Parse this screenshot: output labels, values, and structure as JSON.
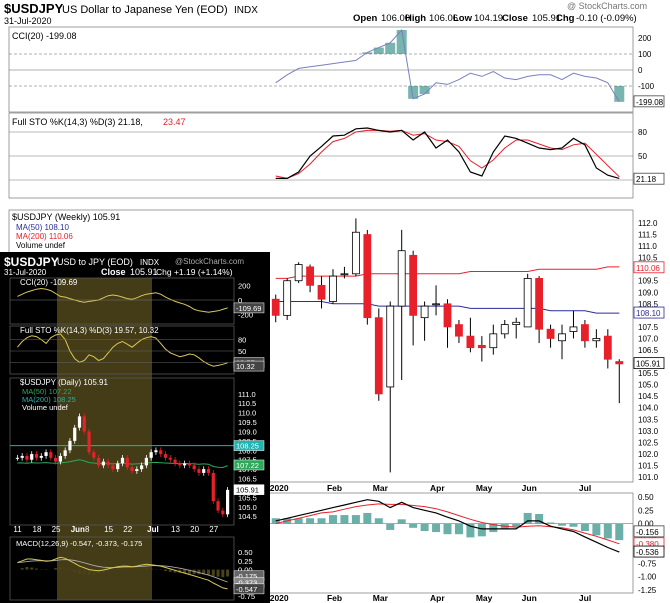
{
  "header": {
    "symbol": "$USDJPY",
    "name": "US Dollar to Japanese Yen (EOD)",
    "exchange": "INDX",
    "date": "31-Jul-2020",
    "watermark": "@ StockCharts.com",
    "quote": {
      "open_label": "Open",
      "open": "106.00",
      "high_label": "High",
      "high": "106.06",
      "low_label": "Low",
      "low": "104.19",
      "close_label": "Close",
      "close": "105.91",
      "chg_label": "Chg",
      "chg": "-0.10 (-0.09%)"
    }
  },
  "weekly": {
    "cci_label": "CCI(20) -199.08",
    "cci_last": "-199.08",
    "sto_label_a": "Full STO %K(14,3) %D(3) 21.18,",
    "sto_label_b": "23.47",
    "sto_last": "21.18",
    "price_label": "$USDJPY (Weekly) 105.91",
    "ma50_label": "MA(50) 108.10",
    "ma200_label": "MA(200) 110.06",
    "volume_label": "Volume undef",
    "ma50_last": "108.10",
    "ma200_last": "110.06",
    "close_last": "105.91",
    "x_labels": [
      "2020",
      "Feb",
      "Mar",
      "Apr",
      "May",
      "Jun",
      "Jul"
    ],
    "cci_ticks": [
      "200",
      "100",
      "0",
      "-100",
      "-200"
    ],
    "sto_ticks": [
      "80",
      "50",
      "20"
    ],
    "price_ticks": [
      "112.0",
      "111.5",
      "111.0",
      "110.5",
      "110.0",
      "109.5",
      "109.0",
      "108.5",
      "108.0",
      "107.5",
      "107.0",
      "106.5",
      "106.0",
      "105.5",
      "105.0",
      "104.5",
      "104.0",
      "103.5",
      "103.0",
      "102.5",
      "102.0",
      "101.5",
      "101.0"
    ],
    "macd_ticks": [
      "0.50",
      "0.25",
      "0.00",
      "-0.25",
      "-0.50",
      "-0.75",
      "-1.00",
      "-1.25"
    ],
    "macd_last_vals": [
      "-0.156",
      "-0.380",
      "-0.536"
    ]
  },
  "daily": {
    "title": "$USDJPY",
    "name": "USD to JPY (EOD)",
    "exchange": "INDX",
    "date": "31-Jul-2020",
    "watermark": "@StockCharts.com",
    "close_label": "Close",
    "close": "105.91",
    "chg": "Chg +1.19 (+1.14%)",
    "cci_label": "CCI(20) -109.69",
    "cci_last": "-109.69",
    "sto_label": "Full STO %K(14,3) %D(3) 19.57, 10.32",
    "sto_last_a": "19.57",
    "sto_last_b": "10.32",
    "price_label": "$USDJPY (Daily) 105.91",
    "ma50_label": "MA(50) 107.22",
    "ma200_label": "MA(200) 108.25",
    "volume_label": "Volume undef",
    "ma200_last": "108.25",
    "ma50_last": "107.22",
    "close_last": "105.91",
    "macd_label": "MACD(12,26,9) -0.547, -0.373, -0.175",
    "macd_last": [
      "-0.175",
      "-0.373",
      "-0.547"
    ],
    "cci_ticks": [
      "200",
      "0",
      "-200"
    ],
    "sto_ticks": [
      "80",
      "50",
      "20"
    ],
    "price_ticks": [
      "111.0",
      "110.5",
      "110.0",
      "109.5",
      "109.0",
      "108.5",
      "108.0",
      "107.5",
      "107.0",
      "106.5",
      "106.0",
      "105.5",
      "105.0",
      "104.5"
    ],
    "macd_ticks": [
      "0.50",
      "0.25",
      "0.00",
      "-0.25",
      "-0.50",
      "-0.75"
    ],
    "x_labels": [
      "11",
      "18",
      "25",
      "Jun",
      "8",
      "15",
      "22",
      "Jul",
      "13",
      "20",
      "27"
    ]
  },
  "colors": {
    "up": "#ffffff",
    "down": "#e8202a",
    "ma50": "#2b2b9a",
    "ma200": "#e8202a",
    "sto_d": "#e8202a",
    "cci_fill": "#5fa8a0",
    "macd_hist": "#6ab0a8",
    "daily_bg": "#000000",
    "daily_shade": "#4a4318",
    "daily_line": "#d8c85a",
    "daily_ma50": "#2ea85a",
    "daily_ma200": "#1fb5b0"
  },
  "chart_data": [
    {
      "type": "candlestick",
      "title": "$USDJPY (Weekly) 105.91",
      "timeframe": "weekly",
      "ylim": [
        101.0,
        112.0
      ],
      "x": [
        "2019-12-30",
        "2020-01-06",
        "2020-01-13",
        "2020-01-20",
        "2020-01-27",
        "2020-02-03",
        "2020-02-10",
        "2020-02-17",
        "2020-02-24",
        "2020-03-02",
        "2020-03-09",
        "2020-03-16",
        "2020-03-23",
        "2020-03-30",
        "2020-04-06",
        "2020-04-13",
        "2020-04-20",
        "2020-04-27",
        "2020-05-04",
        "2020-05-11",
        "2020-05-18",
        "2020-05-25",
        "2020-06-01",
        "2020-06-08",
        "2020-06-15",
        "2020-06-22",
        "2020-06-29",
        "2020-07-06",
        "2020-07-13",
        "2020-07-20",
        "2020-07-27"
      ],
      "ohlc": [
        [
          108.7,
          108.9,
          107.7,
          108.0
        ],
        [
          108.0,
          109.6,
          107.8,
          109.5
        ],
        [
          109.5,
          110.3,
          109.4,
          110.2
        ],
        [
          110.1,
          110.2,
          109.0,
          109.3
        ],
        [
          109.3,
          109.7,
          108.3,
          108.7
        ],
        [
          108.6,
          110.0,
          108.5,
          109.7
        ],
        [
          109.8,
          110.1,
          109.6,
          109.8
        ],
        [
          109.8,
          112.2,
          109.7,
          111.6
        ],
        [
          111.5,
          111.7,
          107.6,
          107.9
        ],
        [
          107.9,
          108.3,
          104.3,
          104.6
        ],
        [
          104.9,
          108.6,
          101.2,
          108.4
        ],
        [
          108.4,
          111.7,
          105.2,
          110.8
        ],
        [
          110.6,
          110.8,
          106.7,
          108.0
        ],
        [
          107.9,
          108.6,
          106.9,
          108.4
        ],
        [
          108.5,
          109.3,
          108.0,
          108.5
        ],
        [
          108.5,
          108.7,
          106.6,
          107.5
        ],
        [
          107.6,
          107.8,
          106.8,
          107.1
        ],
        [
          107.1,
          107.9,
          106.4,
          106.6
        ],
        [
          106.7,
          107.1,
          106.0,
          106.6
        ],
        [
          106.6,
          107.6,
          106.3,
          107.2
        ],
        [
          107.2,
          107.8,
          107.0,
          107.6
        ],
        [
          107.6,
          107.9,
          107.0,
          107.7
        ],
        [
          107.5,
          109.8,
          107.5,
          109.6
        ],
        [
          109.6,
          109.7,
          106.8,
          107.4
        ],
        [
          107.4,
          107.6,
          106.6,
          107.0
        ],
        [
          106.9,
          107.6,
          106.1,
          107.2
        ],
        [
          107.3,
          108.2,
          107.0,
          107.5
        ],
        [
          107.6,
          107.8,
          106.6,
          106.9
        ],
        [
          106.9,
          107.4,
          106.6,
          107.0
        ],
        [
          107.1,
          107.4,
          105.7,
          106.1
        ],
        [
          106.0,
          106.1,
          104.2,
          105.9
        ]
      ],
      "series": [
        {
          "name": "MA(50)",
          "values": [
            108.6,
            108.6,
            108.6,
            108.6,
            108.6,
            108.5,
            108.5,
            108.5,
            108.5,
            108.4,
            108.4,
            108.4,
            108.4,
            108.4,
            108.4,
            108.4,
            108.4,
            108.3,
            108.3,
            108.3,
            108.3,
            108.3,
            108.3,
            108.3,
            108.2,
            108.2,
            108.2,
            108.2,
            108.1,
            108.1,
            108.1
          ]
        },
        {
          "name": "MA(200)",
          "values": [
            109.6,
            109.6,
            109.7,
            109.7,
            109.7,
            109.7,
            109.7,
            109.7,
            109.8,
            109.8,
            109.8,
            109.8,
            109.8,
            109.8,
            109.8,
            109.8,
            109.8,
            109.9,
            109.9,
            109.9,
            109.9,
            109.9,
            109.9,
            110.0,
            110.0,
            110.0,
            110.0,
            110.0,
            110.0,
            110.1,
            110.1
          ]
        }
      ],
      "indicators": {
        "cci": {
          "label": "CCI(20)",
          "last": -199.08,
          "ylim": [
            -250,
            250
          ],
          "values": [
            -80,
            -30,
            10,
            20,
            30,
            40,
            50,
            60,
            110,
            140,
            170,
            250,
            -180,
            -150,
            -80,
            -90,
            -60,
            -20,
            -40,
            -10,
            -50,
            -60,
            -40,
            -30,
            -30,
            -60,
            -20,
            -40,
            -50,
            -80,
            -199
          ]
        },
        "full_sto": {
          "label": "Full STO %K(14,3) %D(3)",
          "k_last": 21.18,
          "d_last": 23.47,
          "ylim": [
            0,
            100
          ],
          "k": [
            22,
            22,
            30,
            50,
            62,
            75,
            76,
            84,
            85,
            82,
            80,
            82,
            70,
            80,
            60,
            70,
            55,
            30,
            25,
            55,
            75,
            72,
            66,
            60,
            58,
            60,
            72,
            64,
            35,
            26,
            22
          ],
          "d": [
            25,
            22,
            28,
            40,
            55,
            68,
            72,
            80,
            82,
            82,
            81,
            82,
            76,
            78,
            70,
            68,
            62,
            44,
            35,
            45,
            60,
            70,
            70,
            65,
            60,
            58,
            64,
            66,
            52,
            38,
            24
          ]
        },
        "macd": {
          "ylim": [
            -1.25,
            0.5
          ],
          "last": [
            -0.156,
            -0.38,
            -0.536
          ]
        }
      }
    },
    {
      "type": "candlestick",
      "title": "$USDJPY (Daily) 105.91",
      "timeframe": "daily",
      "ylim": [
        104.3,
        111.2
      ],
      "close_values": [
        107.6,
        107.7,
        107.5,
        107.8,
        107.6,
        107.7,
        107.9,
        107.6,
        107.4,
        107.7,
        108.0,
        108.5,
        109.2,
        109.8,
        109.0,
        107.9,
        107.6,
        107.2,
        107.4,
        107.2,
        107.0,
        107.3,
        107.6,
        107.1,
        106.9,
        107.0,
        107.2,
        107.6,
        107.9,
        108.0,
        107.8,
        107.6,
        107.5,
        107.3,
        107.2,
        107.3,
        107.2,
        107.0,
        106.8,
        107.0,
        106.8,
        105.3,
        104.8,
        104.6,
        105.9
      ],
      "series": [
        {
          "name": "MA(50)",
          "last": 107.22
        },
        {
          "name": "MA(200)",
          "last": 108.25
        }
      ],
      "indicators": {
        "cci": {
          "label": "CCI(20)",
          "last": -109.69,
          "ylim": [
            -250,
            250
          ]
        },
        "full_sto": {
          "label": "Full STO %K(14,3) %D(3)",
          "k_last": 19.57,
          "d_last": 10.32
        },
        "macd": {
          "label": "MACD(12,26,9)",
          "macd": -0.547,
          "signal": -0.373,
          "hist": -0.175,
          "ylim": [
            -0.75,
            0.5
          ]
        }
      }
    }
  ]
}
